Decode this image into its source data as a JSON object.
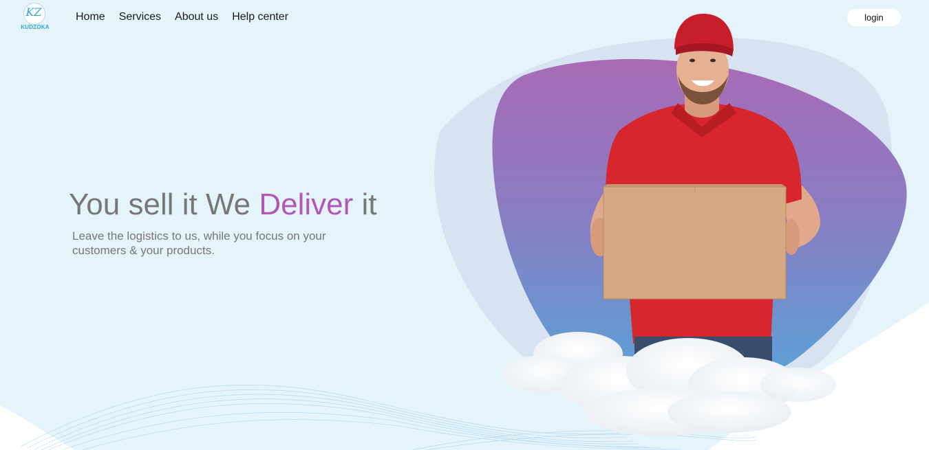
{
  "brand": {
    "logo_monogram": "KZ",
    "logo_text": "KUDZOKA"
  },
  "nav": {
    "items": [
      "Home",
      "Services",
      "About us",
      "Help center"
    ]
  },
  "header": {
    "login_label": "login"
  },
  "hero": {
    "title_part1": "You sell it We ",
    "title_accent": "Deliver",
    "title_part2": " it",
    "subtitle": "Leave the logistics to us, while you focus on your customers & your products."
  },
  "colors": {
    "background": "#e5f3fa",
    "accent_purple": "#b058b3",
    "text_gray": "#777777",
    "logo_blue": "#2aa8d4",
    "shirt_red": "#d8262e"
  },
  "illustration": {
    "subject": "delivery man in red cap and red polo shirt holding a cardboard box",
    "backdrop": "purple-to-blue gradient blob with clouds"
  }
}
